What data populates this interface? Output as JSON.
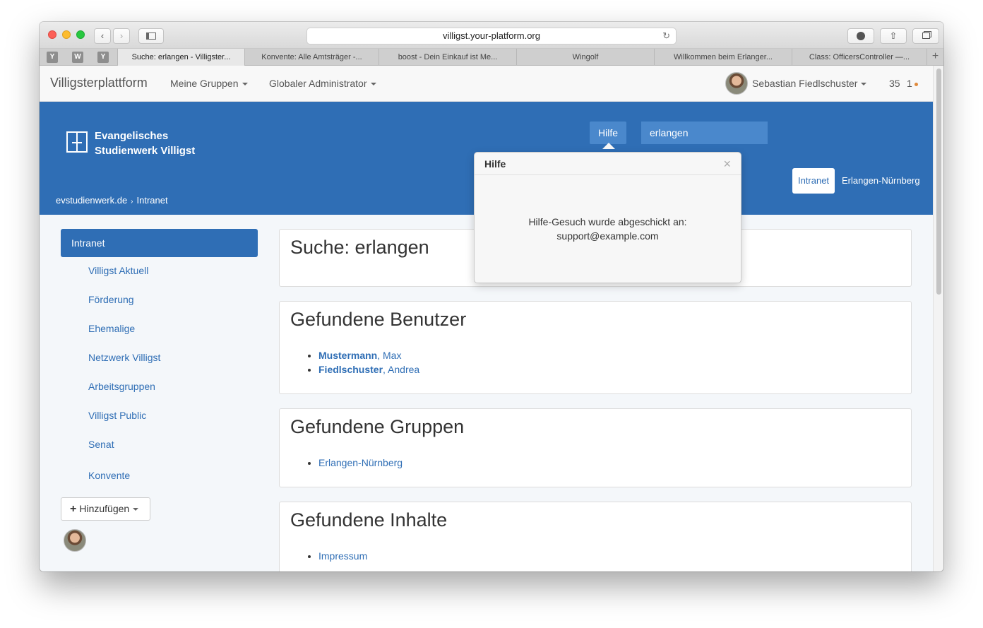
{
  "browser": {
    "url": "villigst.your-platform.org",
    "pinned_tabs": [
      "Y",
      "W",
      "Y"
    ],
    "tabs": [
      {
        "label": "Suche: erlangen - Villigster..."
      },
      {
        "label": "Konvente: Alle Amtsträger -..."
      },
      {
        "label": "boost - Dein Einkauf ist Me..."
      },
      {
        "label": "Wingolf"
      },
      {
        "label": "Willkommen beim Erlanger..."
      },
      {
        "label": "Class: OfficersController —..."
      }
    ],
    "new_tab": "+"
  },
  "navbar": {
    "brand": "Villigsterplattform",
    "menus": [
      "Meine Gruppen",
      "Globaler Administrator"
    ],
    "user_name": "Sebastian Fiedlschuster",
    "counter_a": "35",
    "counter_b": "1"
  },
  "hero": {
    "logo_line1": "Evangelisches",
    "logo_line2": "Studienwerk Villigst",
    "hilfe_label": "Hilfe",
    "search_value": "erlangen",
    "breadcrumb": [
      "evstudienwerk.de",
      "Intranet"
    ],
    "breadcrumb_sep": "›",
    "pill_active": "Intranet",
    "pill_other": "Erlangen-Nürnberg"
  },
  "popover": {
    "title": "Hilfe",
    "close": "×",
    "line1": "Hilfe-Gesuch wurde abgeschickt an:",
    "line2": "support@example.com"
  },
  "sidebar": {
    "active": "Intranet",
    "items": [
      "Villigst Aktuell",
      "Förderung",
      "Ehemalige",
      "Netzwerk Villigst",
      "Arbeitsgruppen",
      "Villigst Public",
      "Senat",
      "Konvente"
    ],
    "add_plus": "+",
    "add_label": "Hinzufügen"
  },
  "main": {
    "search_title": "Suche: erlangen",
    "users_title": "Gefundene Benutzer",
    "users": [
      {
        "last": "Mustermann",
        "first": ", Max"
      },
      {
        "last": "Fiedlschuster",
        "first": ", Andrea"
      }
    ],
    "groups_title": "Gefundene Gruppen",
    "groups": [
      "Erlangen-Nürnberg"
    ],
    "content_title": "Gefundene Inhalte",
    "content": [
      "Impressum"
    ]
  },
  "colors": {
    "primary_blue": "#2f6eb5",
    "hero_input": "#4a88cc"
  }
}
